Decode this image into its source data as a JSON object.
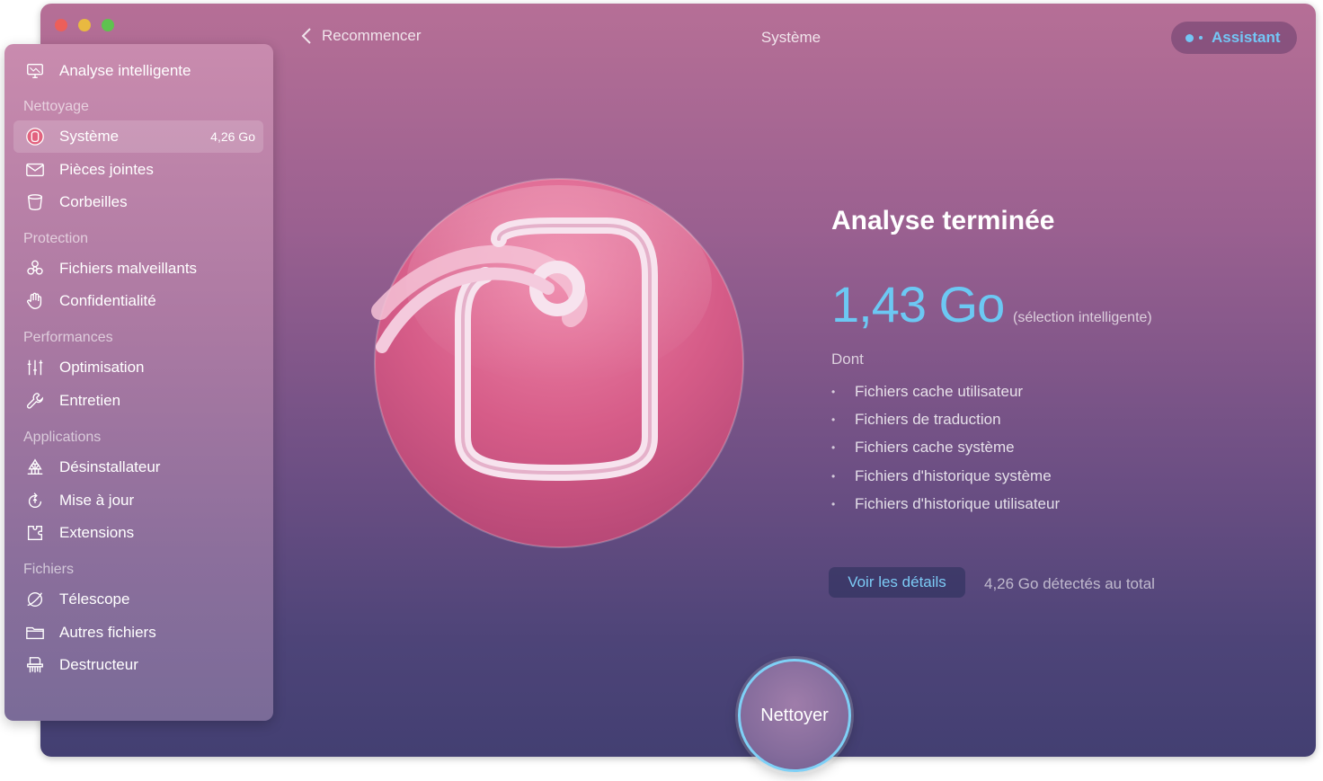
{
  "app": {
    "section_title": "Système",
    "back_label": "Recommencer",
    "assistant_label": "Assistant",
    "colors": {
      "accent": "#6cc8f3",
      "sidebar_top": "#c98bae",
      "window_bottom": "#433f72"
    }
  },
  "sidebar": {
    "top_item": {
      "label": "Analyse intelligente",
      "icon": "monitor-icon"
    },
    "sections": [
      {
        "header": "Nettoyage",
        "items": [
          {
            "label": "Système",
            "icon": "system-junk-icon",
            "size": "4,26 Go",
            "active": true
          },
          {
            "label": "Pièces jointes",
            "icon": "mail-icon"
          },
          {
            "label": "Corbeilles",
            "icon": "trash-bin-icon"
          }
        ]
      },
      {
        "header": "Protection",
        "items": [
          {
            "label": "Fichiers malveillants",
            "icon": "biohazard-icon"
          },
          {
            "label": "Confidentialité",
            "icon": "hand-icon"
          }
        ]
      },
      {
        "header": "Performances",
        "items": [
          {
            "label": "Optimisation",
            "icon": "sliders-icon"
          },
          {
            "label": "Entretien",
            "icon": "wrench-icon"
          }
        ]
      },
      {
        "header": "Applications",
        "items": [
          {
            "label": "Désinstallateur",
            "icon": "uninstaller-icon"
          },
          {
            "label": "Mise à jour",
            "icon": "update-icon"
          },
          {
            "label": "Extensions",
            "icon": "extensions-icon"
          }
        ]
      },
      {
        "header": "Fichiers",
        "items": [
          {
            "label": "Télescope",
            "icon": "telescope-icon"
          },
          {
            "label": "Autres fichiers",
            "icon": "folder-icon"
          },
          {
            "label": "Destructeur",
            "icon": "shredder-icon"
          }
        ]
      }
    ]
  },
  "result": {
    "title": "Analyse terminée",
    "size": "1,43 Go",
    "size_note": "(sélection intelligente)",
    "includes_label": "Dont",
    "includes": [
      "Fichiers cache utilisateur",
      "Fichiers de traduction",
      "Fichiers cache système",
      "Fichiers d'historique système",
      "Fichiers d'historique utilisateur"
    ],
    "details_button": "Voir les détails",
    "total": "4,26 Go détectés au total"
  },
  "clean_button": "Nettoyer"
}
